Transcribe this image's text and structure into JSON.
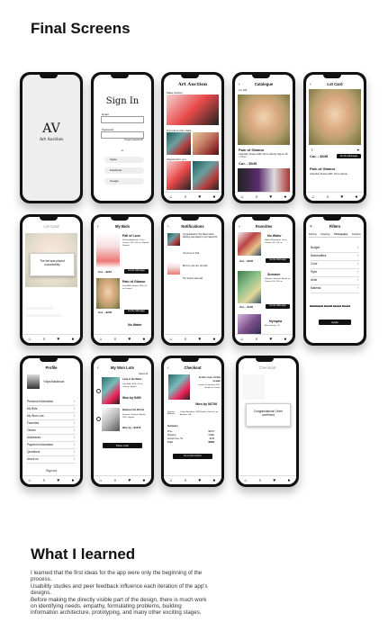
{
  "headings": {
    "final_screens": "Final Screens",
    "what_i_learned": "What I learned"
  },
  "learned_text": "I learned that the first ideas for the app were only the beginning of the process.\nUsability studies and peer feedback influence each iteration of the app's designs.\nBefore making the directly visible part of the design, there is much work on identifying needs, empathy, formulating problems, building information architecture, prototyping, and many other exciting stages.",
  "splash": {
    "logo_mark": "AV",
    "logo_text": "Art Auction"
  },
  "signin": {
    "title": "Sign In",
    "email_label": "Email",
    "password_label": "Password",
    "forgot": "Forgot password?",
    "or": "or",
    "apple": "Apple",
    "facebook": "Facebook",
    "google": "Google"
  },
  "home": {
    "title": "Art Auction",
    "section1": "Make Auction",
    "section2": "Sometime Also Sells",
    "section3": "Selected for you"
  },
  "catalogue": {
    "title": "Catalogue",
    "subtitle": "Lot 1/22",
    "painting": "Pain of Glamor",
    "meta": "Julia Mell, Ukraine 2020, Oil on Canvas, Signed, 90 × 70 cm",
    "price": "Cur. - $345",
    "bid_label": "Bid"
  },
  "lot_card": {
    "title": "Lot Card",
    "painting": "Pain of Glamor",
    "meta": "Julia Mell, Ukraine 2020, Oil on Canvas",
    "price": "Cur. - $345",
    "bid_button": "Set the bid/budget"
  },
  "lot_card_modal": {
    "title": "Lot Card",
    "message": "The bid was placed successfully",
    "ok": "OK"
  },
  "my_bids": {
    "title": "My Bids",
    "items": [
      {
        "name": "Fall of Love",
        "meta": "Dorothy Anderson, Oil on Canvas, 120 × 80 cm, Signed, Framed",
        "price": "Cur. - $210",
        "button": "Set the bid/budget"
      },
      {
        "name": "Pain of Glamor",
        "meta": "Julia Mell, Ukraine 2020, Oil on Canvas",
        "price": "Cur. - $345",
        "button": "Set the bid/budget"
      },
      {
        "name": "No Water",
        "meta": "",
        "price": "",
        "button": ""
      }
    ]
  },
  "notifications": {
    "title": "Notifications",
    "items": [
      "Congratulations! The Water Nettle Painting was added to your Saved list",
      "Your lot is on hold",
      "Bid is in your cart. Not sold",
      "The Sunrise was sold"
    ]
  },
  "favorites": {
    "title": "Favorites",
    "items": [
      {
        "name": "No Water",
        "meta": "Matteo Maruyama, Oil on Canvas, 60 × 50 cm",
        "price": "Cur. - $345",
        "button": "Set the bid/budget"
      },
      {
        "name": "Summer",
        "meta": "Katarina Ostrovski, Acrylic on Canvas, 90 × 60 cm",
        "price": "Cur. - $120",
        "button": "Set the bid/budget"
      },
      {
        "name": "Nympha",
        "meta": "Elena Scolari, Oil",
        "price": "",
        "button": ""
      }
    ]
  },
  "filters": {
    "title": "Filters",
    "tabs": [
      "Painting",
      "Drawings",
      "Photography",
      "Sculpture"
    ],
    "rows": [
      "Budget",
      "Nationalities",
      "Color",
      "Style",
      "Artist",
      "Material"
    ],
    "chips": [
      "Oil on canvas",
      "Acrylic",
      "Framed",
      "Signed"
    ],
    "apply": "Apply"
  },
  "profile": {
    "title": "Profile",
    "name": "Yuliya Basildova",
    "rows": [
      "Personal information",
      "My Bids",
      "My Won Lots",
      "Favorites",
      "Orders",
      "Addresses",
      "Payment information",
      "Questions",
      "About us"
    ],
    "signout": "Sign out"
  },
  "won_lots": {
    "title": "My Won Lots",
    "select": "Select All",
    "items": [
      {
        "name": "Lady in the Water",
        "meta": "Julia Mell, 2019, Oil on Canvas, Signed",
        "price": "Won by $490"
      },
      {
        "name": "Between the Words",
        "meta": "Katarina Ostrovski, Acrylic, 2021, Signed",
        "price": "Won by - $1679"
      }
    ],
    "button": "Place order"
  },
  "checkout": {
    "title": "Checkout",
    "painting": "In the rose of the ocean",
    "meta": "Katarina Ostrovski, 2017, Acrylic on Canvas",
    "won": "Won by $6708",
    "delivery_label": "Delivery Address",
    "delivery": "Yuliya Basildova, 1962 Harbor View Dr, Los Angeles, CA",
    "summary_label": "Summary",
    "summary": [
      {
        "k": "Price",
        "v": "$6670"
      },
      {
        "k": "Shipping",
        "v": "FREE"
      },
      {
        "k": "Auction Fee 7%",
        "v": "$138"
      },
      {
        "k": "Total",
        "v": "$6808"
      }
    ],
    "button": "Go to bid confirm"
  },
  "checkout_done": {
    "title": "Checkout",
    "message": "Congratulations! Order confirmed",
    "ok": "OK"
  },
  "tab_icons": [
    "home-icon",
    "search-icon",
    "heart-icon",
    "user-icon"
  ]
}
